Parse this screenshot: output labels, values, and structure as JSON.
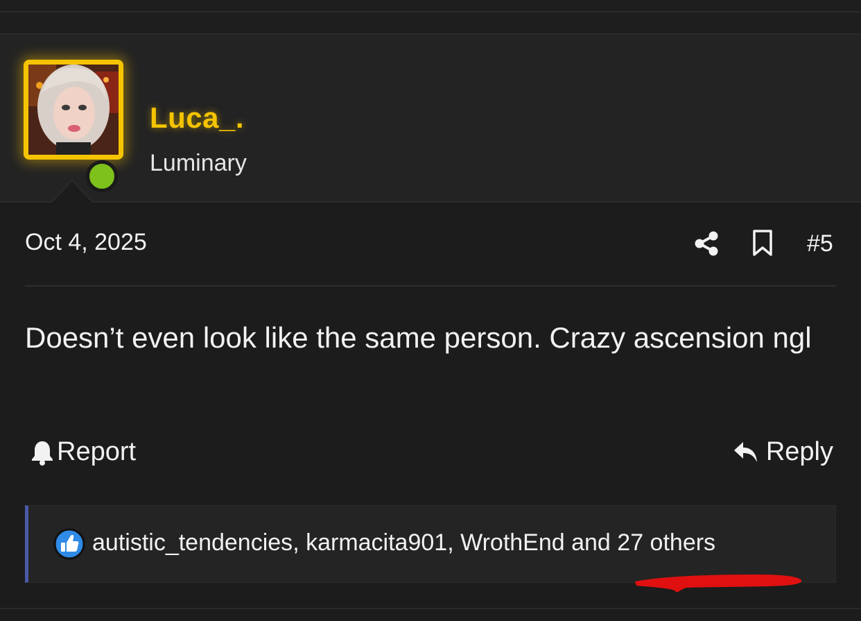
{
  "post": {
    "username": "Luca_.",
    "user_title": "Luminary",
    "date": "Oct 4, 2025",
    "post_number": "#5",
    "body": "Doesn’t even look like the same person. Crazy ascension ngl",
    "report_label": "Report",
    "reply_label": "Reply"
  },
  "reactions": {
    "users": [
      "autistic_tendencies",
      "karmacita901",
      "WrothEnd"
    ],
    "separator": ", ",
    "and_label": " and ",
    "others": "27 others"
  },
  "icons": {
    "avatar": "user-avatar-image",
    "online": "online-status-dot",
    "share": "share-icon",
    "bookmark": "bookmark-icon",
    "report": "bell-icon",
    "reply": "reply-arrow-icon",
    "like": "thumbs-up-icon"
  },
  "colors": {
    "background": "#1c1c1c",
    "header_background": "#232323",
    "username": "#f5c400",
    "online": "#7ec01c",
    "reactions_accent": "#4a5aa8",
    "like_icon": "#2f8be6",
    "annotation": "#e01010"
  }
}
